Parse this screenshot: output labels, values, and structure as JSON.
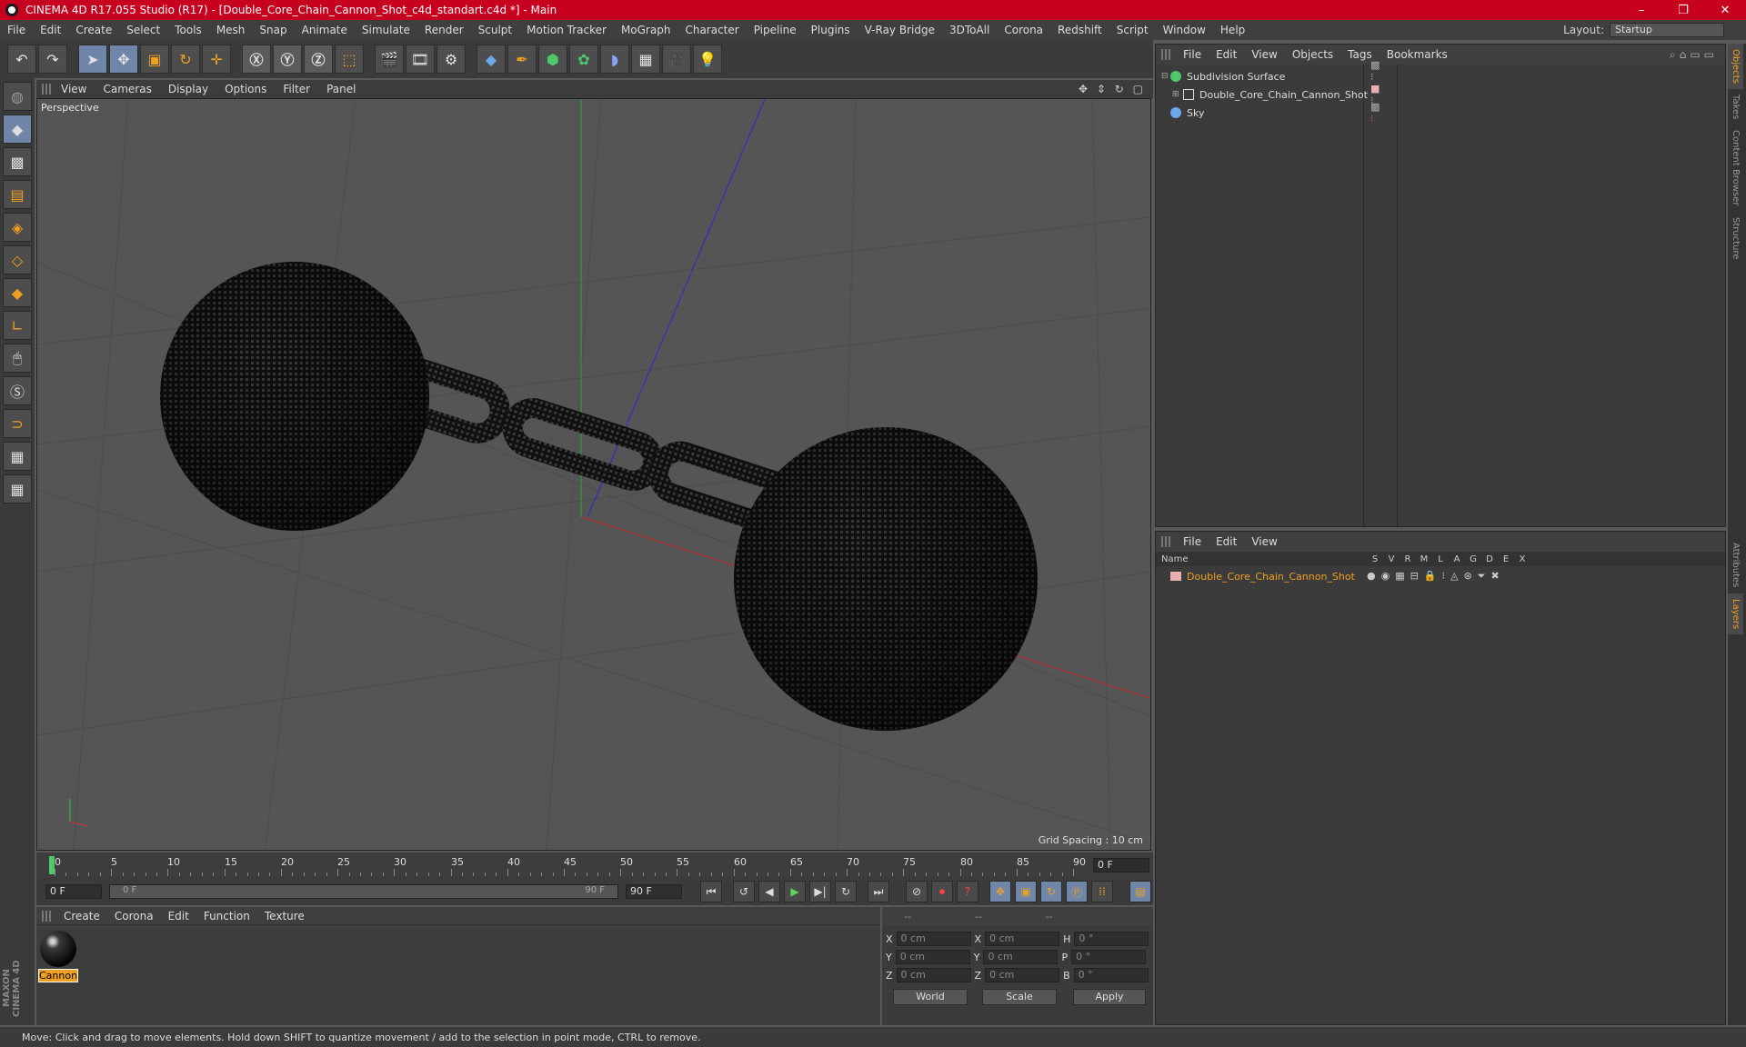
{
  "window": {
    "title": "CINEMA 4D R17.055 Studio (R17) - [Double_Core_Chain_Cannon_Shot_c4d_standart.c4d *] - Main",
    "controls": [
      "–",
      "❐",
      "✕"
    ]
  },
  "menubar": {
    "items": [
      "File",
      "Edit",
      "Create",
      "Select",
      "Tools",
      "Mesh",
      "Snap",
      "Animate",
      "Simulate",
      "Render",
      "Sculpt",
      "Motion Tracker",
      "MoGraph",
      "Character",
      "Pipeline",
      "Plugins",
      "V-Ray Bridge",
      "3DToAll",
      "Corona",
      "Redshift",
      "Script",
      "Window",
      "Help"
    ],
    "layout_label": "Layout:",
    "layout_value": "Startup"
  },
  "viewport": {
    "menu": [
      "View",
      "Cameras",
      "Display",
      "Options",
      "Filter",
      "Panel"
    ],
    "nav_icons": "✥ ⇕ ↻ ▢",
    "camera_label": "Perspective",
    "grid_spacing": "Grid Spacing : 10 cm"
  },
  "timeline": {
    "ticks": [
      "0",
      "5",
      "10",
      "15",
      "20",
      "25",
      "30",
      "35",
      "40",
      "45",
      "50",
      "55",
      "60",
      "65",
      "70",
      "75",
      "80",
      "85",
      "90"
    ],
    "current_frame": "0 F"
  },
  "playback": {
    "start_field": "0 F",
    "range_start": "0 F",
    "range_end": "90 F",
    "end_field": "90 F"
  },
  "material_manager": {
    "menu": [
      "Create",
      "Corona",
      "Edit",
      "Function",
      "Texture"
    ],
    "materials": [
      {
        "name": "Cannon"
      }
    ]
  },
  "coordinates": {
    "headers": [
      "--",
      "--",
      "--"
    ],
    "rows": [
      {
        "a": "X",
        "v1": "0 cm",
        "b": "X",
        "v2": "0 cm",
        "c": "H",
        "v3": "0 °"
      },
      {
        "a": "Y",
        "v1": "0 cm",
        "b": "Y",
        "v2": "0 cm",
        "c": "P",
        "v3": "0 °"
      },
      {
        "a": "Z",
        "v1": "0 cm",
        "b": "Z",
        "v2": "0 cm",
        "c": "B",
        "v3": "0 °"
      }
    ],
    "mode": "World",
    "type": "Scale",
    "apply": "Apply"
  },
  "object_manager": {
    "menu": [
      "File",
      "Edit",
      "View",
      "Objects",
      "Tags",
      "Bookmarks"
    ],
    "objects": [
      {
        "name": "Subdivision Surface",
        "color": "#4fc86b"
      },
      {
        "name": "Double_Core_Chain_Cannon_Shot",
        "color": "#e0e0e0"
      },
      {
        "name": "Sky",
        "color": "#6aa8e8"
      }
    ]
  },
  "layer_manager": {
    "menu": [
      "File",
      "Edit",
      "View"
    ],
    "columns": [
      "Name",
      "S",
      "V",
      "R",
      "M",
      "L",
      "A",
      "G",
      "D",
      "E",
      "X"
    ],
    "layers": [
      {
        "name": "Double_Core_Chain_Cannon_Shot",
        "color": "#f0a020"
      }
    ]
  },
  "side_tabs": [
    "Objects",
    "Takes",
    "Content Browser",
    "Structure",
    "Attributes",
    "Layers"
  ],
  "status": "Move: Click and drag to move elements. Hold down SHIFT to quantize movement / add to the selection in point mode, CTRL to remove.",
  "brand": "MAXON CINEMA 4D"
}
